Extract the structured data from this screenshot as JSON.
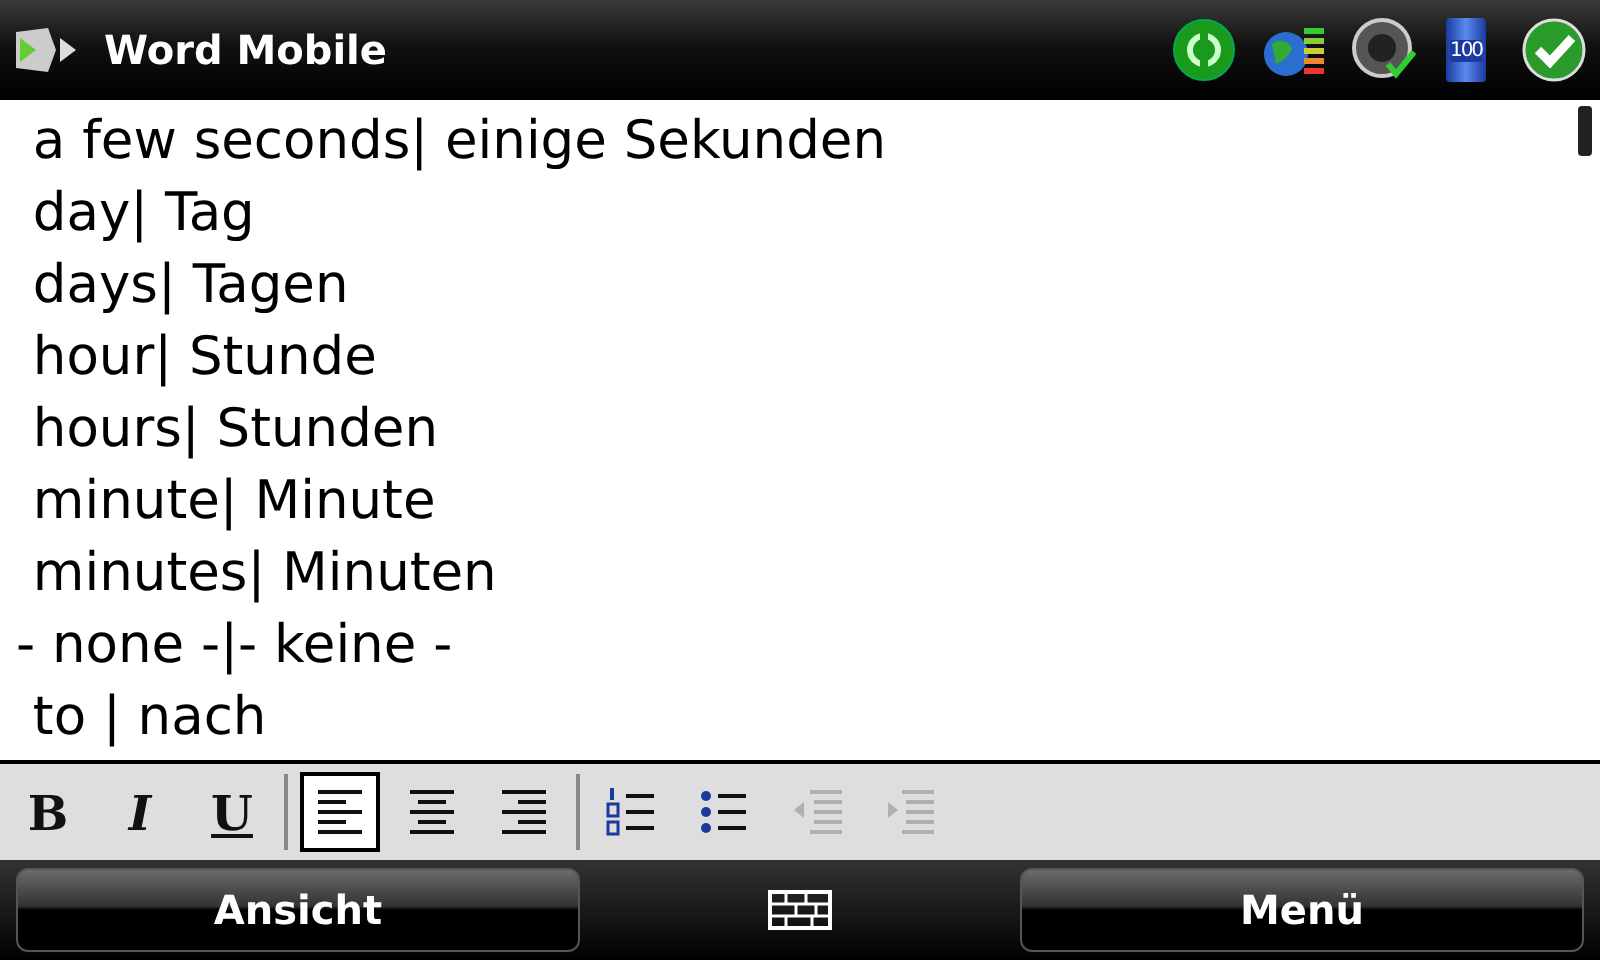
{
  "window": {
    "title": "Word Mobile",
    "battery_label": "100"
  },
  "document": {
    "lines": [
      " a few seconds| einige Sekunden",
      " day| Tag",
      " days| Tagen",
      " hour| Stunde",
      " hours| Stunden",
      " minute| Minute",
      " minutes| Minuten",
      "- none -|- keine -",
      " to | nach"
    ]
  },
  "toolbar": [
    {
      "kind": "bold",
      "label": "B",
      "selected": false,
      "disabled": false
    },
    {
      "kind": "italic",
      "label": "I",
      "selected": false,
      "disabled": false
    },
    {
      "kind": "underline",
      "label": "U",
      "selected": false,
      "disabled": false
    },
    {
      "kind": "separator"
    },
    {
      "kind": "align-left",
      "selected": true,
      "disabled": false
    },
    {
      "kind": "align-center",
      "selected": false,
      "disabled": false
    },
    {
      "kind": "align-right",
      "selected": false,
      "disabled": false
    },
    {
      "kind": "separator"
    },
    {
      "kind": "numbered-list",
      "selected": false,
      "disabled": false
    },
    {
      "kind": "bulleted-list",
      "selected": false,
      "disabled": false
    },
    {
      "kind": "outdent",
      "selected": false,
      "disabled": true
    },
    {
      "kind": "indent",
      "selected": false,
      "disabled": true
    }
  ],
  "softkeys": {
    "left": "Ansicht",
    "right": "Menü"
  }
}
